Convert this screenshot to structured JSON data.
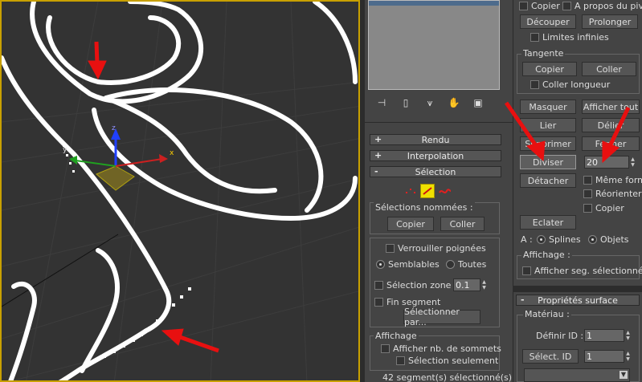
{
  "middle": {
    "rollouts": {
      "rendu": "Rendu",
      "interpolation": "Interpolation",
      "selection": "Sélection",
      "plus": "+",
      "minus": "-"
    },
    "selections_nommees": {
      "title": "Sélections nommées :",
      "copier": "Copier",
      "coller": "Coller"
    },
    "verrouiller": "Verrouiller poignées",
    "semblables": "Semblables",
    "toutes": "Toutes",
    "selection_zone": "Sélection zone :",
    "selection_zone_value": "0.1",
    "fin_segment": "Fin segment",
    "selectionner_par": "Sélectionner par...",
    "affichage": {
      "title": "Affichage",
      "afficher_nb": "Afficher nb. de sommets",
      "selection_seulement": "Sélection seulement"
    },
    "status": "42 segment(s) sélectionné(s)"
  },
  "right": {
    "copier": "Copier",
    "a_propos": "A propos du pivot",
    "decouper": "Découper",
    "prolonger": "Prolonger",
    "limites_infinies": "Limites infinies",
    "tangente": {
      "title": "Tangente",
      "copier": "Copier",
      "coller": "Coller",
      "coller_longueur": "Coller longueur"
    },
    "masquer": "Masquer",
    "afficher_tout": "Afficher tout",
    "lier": "Lier",
    "delier": "Délier",
    "supprimer": "Supprimer",
    "fermer": "Fermer",
    "diviser": "Diviser",
    "diviser_value": "20",
    "detacher": "Détacher",
    "meme_forme": "Même forme",
    "reorienter": "Réorienter",
    "copier2": "Copier",
    "eclater": "Eclater",
    "a_label": "A :",
    "splines": "Splines",
    "objets": "Objets",
    "affichage": {
      "title": "Affichage :",
      "afficher_seg": "Afficher seg. sélectionnés"
    },
    "proprietes": {
      "title": "Propriétés surface",
      "materiau": "Matériau :",
      "definir_id": "Définir ID :",
      "definir_value": "1",
      "select_id": "Sélect. ID",
      "select_value": "1",
      "minus": "-"
    }
  },
  "viewport": {
    "axis_x": "x",
    "axis_y": "y",
    "axis_z": "z"
  },
  "colors": {
    "viewport_border": "#c8a000",
    "arrow": "#e81010",
    "spline": "#ffffff"
  }
}
